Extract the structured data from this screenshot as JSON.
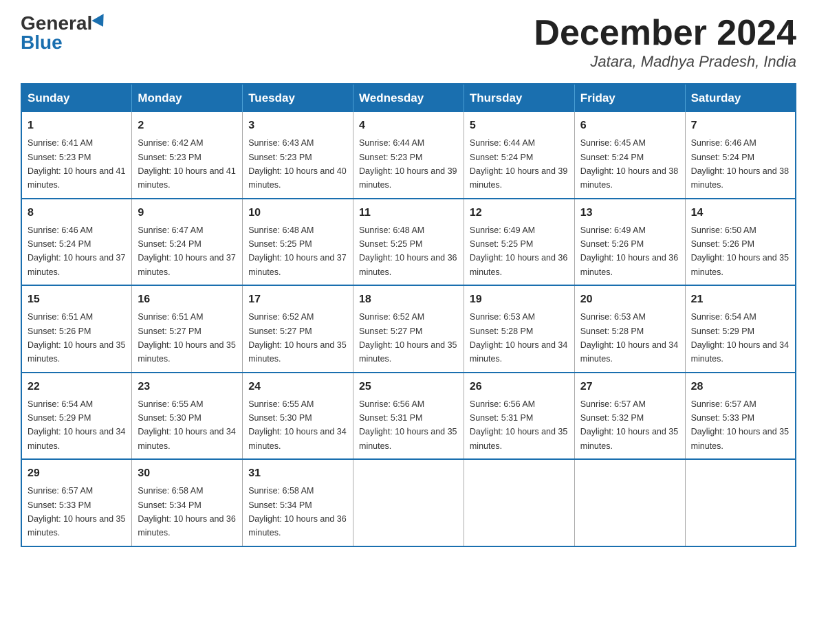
{
  "logo": {
    "general": "General",
    "blue": "Blue"
  },
  "title": "December 2024",
  "location": "Jatara, Madhya Pradesh, India",
  "days_of_week": [
    "Sunday",
    "Monday",
    "Tuesday",
    "Wednesday",
    "Thursday",
    "Friday",
    "Saturday"
  ],
  "weeks": [
    [
      {
        "day": "1",
        "sunrise": "6:41 AM",
        "sunset": "5:23 PM",
        "daylight": "10 hours and 41 minutes."
      },
      {
        "day": "2",
        "sunrise": "6:42 AM",
        "sunset": "5:23 PM",
        "daylight": "10 hours and 41 minutes."
      },
      {
        "day": "3",
        "sunrise": "6:43 AM",
        "sunset": "5:23 PM",
        "daylight": "10 hours and 40 minutes."
      },
      {
        "day": "4",
        "sunrise": "6:44 AM",
        "sunset": "5:23 PM",
        "daylight": "10 hours and 39 minutes."
      },
      {
        "day": "5",
        "sunrise": "6:44 AM",
        "sunset": "5:24 PM",
        "daylight": "10 hours and 39 minutes."
      },
      {
        "day": "6",
        "sunrise": "6:45 AM",
        "sunset": "5:24 PM",
        "daylight": "10 hours and 38 minutes."
      },
      {
        "day": "7",
        "sunrise": "6:46 AM",
        "sunset": "5:24 PM",
        "daylight": "10 hours and 38 minutes."
      }
    ],
    [
      {
        "day": "8",
        "sunrise": "6:46 AM",
        "sunset": "5:24 PM",
        "daylight": "10 hours and 37 minutes."
      },
      {
        "day": "9",
        "sunrise": "6:47 AM",
        "sunset": "5:24 PM",
        "daylight": "10 hours and 37 minutes."
      },
      {
        "day": "10",
        "sunrise": "6:48 AM",
        "sunset": "5:25 PM",
        "daylight": "10 hours and 37 minutes."
      },
      {
        "day": "11",
        "sunrise": "6:48 AM",
        "sunset": "5:25 PM",
        "daylight": "10 hours and 36 minutes."
      },
      {
        "day": "12",
        "sunrise": "6:49 AM",
        "sunset": "5:25 PM",
        "daylight": "10 hours and 36 minutes."
      },
      {
        "day": "13",
        "sunrise": "6:49 AM",
        "sunset": "5:26 PM",
        "daylight": "10 hours and 36 minutes."
      },
      {
        "day": "14",
        "sunrise": "6:50 AM",
        "sunset": "5:26 PM",
        "daylight": "10 hours and 35 minutes."
      }
    ],
    [
      {
        "day": "15",
        "sunrise": "6:51 AM",
        "sunset": "5:26 PM",
        "daylight": "10 hours and 35 minutes."
      },
      {
        "day": "16",
        "sunrise": "6:51 AM",
        "sunset": "5:27 PM",
        "daylight": "10 hours and 35 minutes."
      },
      {
        "day": "17",
        "sunrise": "6:52 AM",
        "sunset": "5:27 PM",
        "daylight": "10 hours and 35 minutes."
      },
      {
        "day": "18",
        "sunrise": "6:52 AM",
        "sunset": "5:27 PM",
        "daylight": "10 hours and 35 minutes."
      },
      {
        "day": "19",
        "sunrise": "6:53 AM",
        "sunset": "5:28 PM",
        "daylight": "10 hours and 34 minutes."
      },
      {
        "day": "20",
        "sunrise": "6:53 AM",
        "sunset": "5:28 PM",
        "daylight": "10 hours and 34 minutes."
      },
      {
        "day": "21",
        "sunrise": "6:54 AM",
        "sunset": "5:29 PM",
        "daylight": "10 hours and 34 minutes."
      }
    ],
    [
      {
        "day": "22",
        "sunrise": "6:54 AM",
        "sunset": "5:29 PM",
        "daylight": "10 hours and 34 minutes."
      },
      {
        "day": "23",
        "sunrise": "6:55 AM",
        "sunset": "5:30 PM",
        "daylight": "10 hours and 34 minutes."
      },
      {
        "day": "24",
        "sunrise": "6:55 AM",
        "sunset": "5:30 PM",
        "daylight": "10 hours and 34 minutes."
      },
      {
        "day": "25",
        "sunrise": "6:56 AM",
        "sunset": "5:31 PM",
        "daylight": "10 hours and 35 minutes."
      },
      {
        "day": "26",
        "sunrise": "6:56 AM",
        "sunset": "5:31 PM",
        "daylight": "10 hours and 35 minutes."
      },
      {
        "day": "27",
        "sunrise": "6:57 AM",
        "sunset": "5:32 PM",
        "daylight": "10 hours and 35 minutes."
      },
      {
        "day": "28",
        "sunrise": "6:57 AM",
        "sunset": "5:33 PM",
        "daylight": "10 hours and 35 minutes."
      }
    ],
    [
      {
        "day": "29",
        "sunrise": "6:57 AM",
        "sunset": "5:33 PM",
        "daylight": "10 hours and 35 minutes."
      },
      {
        "day": "30",
        "sunrise": "6:58 AM",
        "sunset": "5:34 PM",
        "daylight": "10 hours and 36 minutes."
      },
      {
        "day": "31",
        "sunrise": "6:58 AM",
        "sunset": "5:34 PM",
        "daylight": "10 hours and 36 minutes."
      },
      null,
      null,
      null,
      null
    ]
  ]
}
